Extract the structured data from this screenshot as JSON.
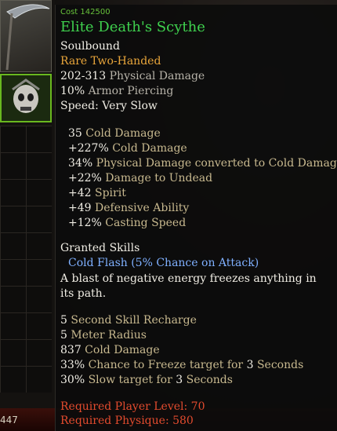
{
  "hud": {
    "gold_count": "447"
  },
  "item": {
    "cost": "Cost  142500",
    "name": "Elite Death's Scythe",
    "binding": "Soulbound",
    "rarity_type": "Rare Two-Handed",
    "base_stats": [
      {
        "value": "202-313",
        "label": " Physical Damage"
      },
      {
        "value": "10%",
        "label": " Armor Piercing"
      },
      {
        "value": "Speed:  Very Slow",
        "label": ""
      }
    ],
    "mods": [
      {
        "value": "35",
        "label": " Cold Damage"
      },
      {
        "value": "+227%",
        "label": " Cold Damage"
      },
      {
        "value": "34%",
        "label": " Physical Damage converted to Cold Damage"
      },
      {
        "value": "+22%",
        "label": " Damage to Undead"
      },
      {
        "value": "+42",
        "label": " Spirit"
      },
      {
        "value": "+49",
        "label": " Defensive Ability"
      },
      {
        "value": "+12%",
        "label": " Casting Speed"
      }
    ],
    "granted_skills_header": "Granted Skills",
    "skill_name": "Cold Flash (5% Chance on Attack)",
    "skill_description": "A blast of negative energy freezes anything in its path.",
    "skill_stats": [
      {
        "value": "5",
        "label": " Second Skill Recharge"
      },
      {
        "value": "5",
        "label": " Meter Radius"
      },
      {
        "value": "837",
        "label": " Cold Damage"
      },
      {
        "value": "33%",
        "label": " Chance to Freeze target for ",
        "extra": "3",
        "tail": " Seconds"
      },
      {
        "value": "30%",
        "label": " Slow target for ",
        "extra": "3",
        "tail": " Seconds"
      }
    ],
    "requirements": [
      "Required Player Level: 70",
      "Required Physique: 580"
    ]
  },
  "colors": {
    "item_name": "#3fd14e",
    "rarity": "#e8a53a",
    "skill": "#7fb0ff",
    "requirement": "#e34b2e"
  }
}
